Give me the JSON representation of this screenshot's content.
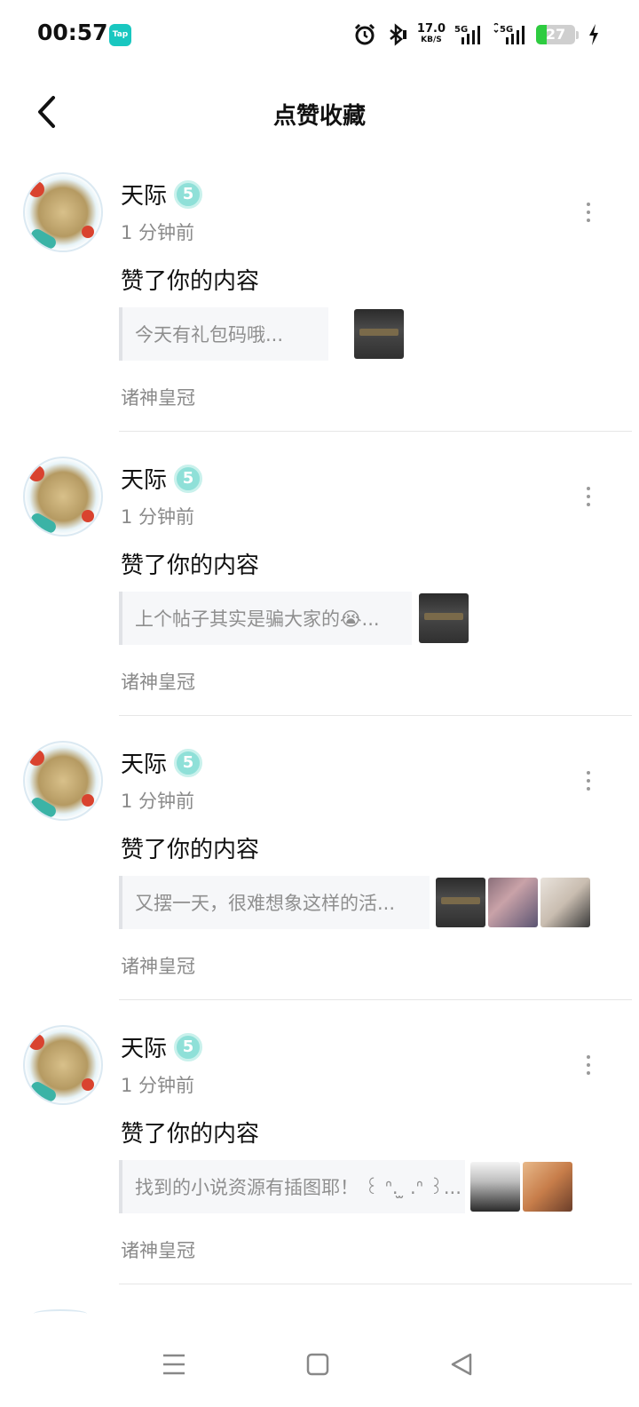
{
  "status_bar": {
    "time": "00:57",
    "app_badge": "Tap",
    "net_speed": "17.0",
    "net_unit": "KB/S",
    "sim1": "5G",
    "sim2": "5G",
    "battery_level": "27",
    "battery_fraction": 0.27
  },
  "header": {
    "title": "点赞收藏"
  },
  "notifications": [
    {
      "user": "天际",
      "badge": "5",
      "time": "1 分钟前",
      "action": "赞了你的内容",
      "preview": "今天有礼包码哦...",
      "game": "诸神皇冠"
    },
    {
      "user": "天际",
      "badge": "5",
      "time": "1 分钟前",
      "action": "赞了你的内容",
      "preview": "上个帖子其实是骗大家的😭...",
      "game": "诸神皇冠"
    },
    {
      "user": "天际",
      "badge": "5",
      "time": "1 分钟前",
      "action": "赞了你的内容",
      "preview": "又摆一天，很难想象这样的活...",
      "game": "诸神皇冠"
    },
    {
      "user": "天际",
      "badge": "5",
      "time": "1 分钟前",
      "action": "赞了你的内容",
      "preview": "找到的小说资源有插图耶！ ꒰ ᐢ. ̫ .ᐢ ꒱...",
      "game": "诸神皇冠"
    }
  ],
  "icons": {
    "back": "chevron-left-icon",
    "more": "more-vertical-icon",
    "nav_menu": "menu-icon",
    "nav_home": "square-home-icon",
    "nav_back": "triangle-back-icon"
  },
  "colors": {
    "accent_teal": "#19c7c0",
    "battery_green": "#2ecc40",
    "muted_text": "#8a8a8a"
  }
}
